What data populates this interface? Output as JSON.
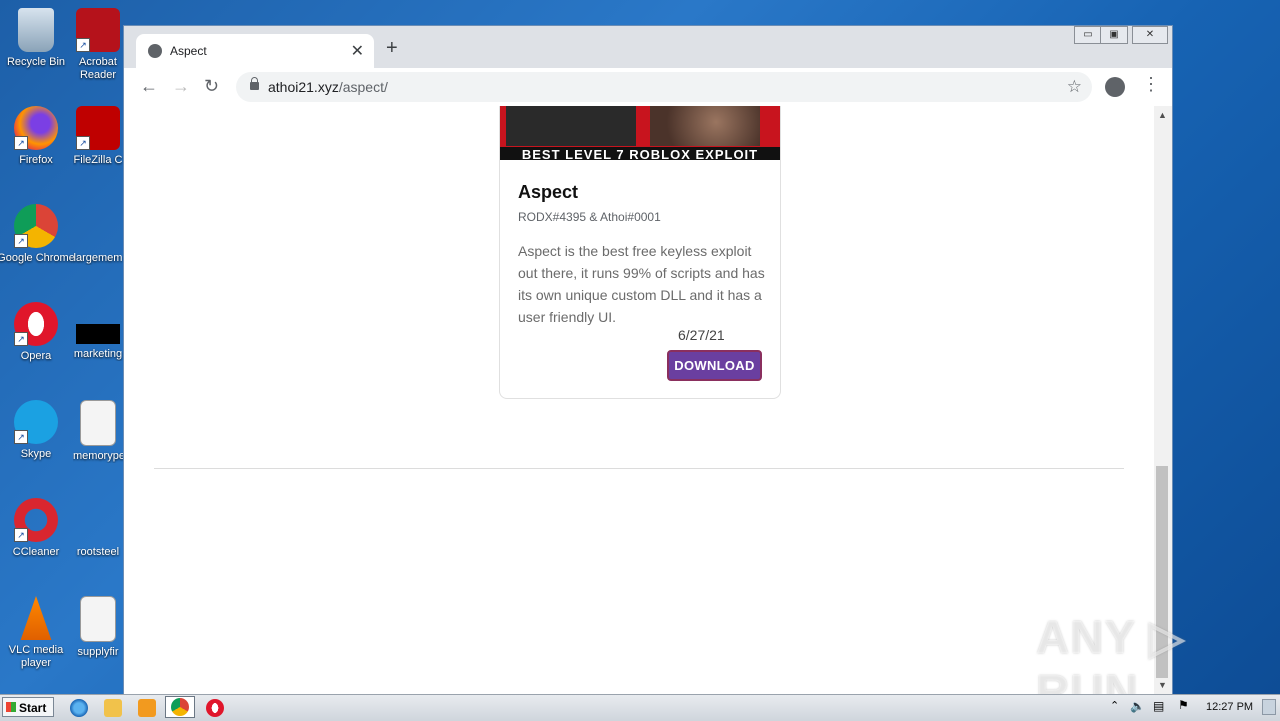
{
  "desktop": {
    "icons": [
      {
        "label": "Recycle Bin"
      },
      {
        "label": "Acrobat Reader"
      },
      {
        "label": "Firefox"
      },
      {
        "label": "FileZilla C"
      },
      {
        "label": "Google Chrome"
      },
      {
        "label": "largemem"
      },
      {
        "label": "Opera"
      },
      {
        "label": "marketing"
      },
      {
        "label": "Skype"
      },
      {
        "label": "memorype"
      },
      {
        "label": "CCleaner"
      },
      {
        "label": "rootsteel"
      },
      {
        "label": "VLC media player"
      },
      {
        "label": "supplyfir"
      }
    ]
  },
  "browser": {
    "tab_title": "Aspect",
    "url_host": "athoi21.xyz",
    "url_path": "/aspect/",
    "new_tab": "+",
    "close_tab": "✕"
  },
  "card": {
    "banner_text": "BEST LEVEL 7 ROBLOX EXPLOIT",
    "title": "Aspect",
    "authors": "RODX#4395 & Athoi#0001",
    "description": "Aspect is the best free keyless exploit out there, it runs 99% of scripts and has its own unique custom DLL and it has a user friendly UI.",
    "date": "6/27/21",
    "button": "DOWNLOAD"
  },
  "watermark": "ANY ▷ RUN",
  "taskbar": {
    "start": "Start",
    "clock": "12:27 PM"
  },
  "colors": {
    "button_bg": "#6a3fa0",
    "banner": "#c8141e"
  }
}
